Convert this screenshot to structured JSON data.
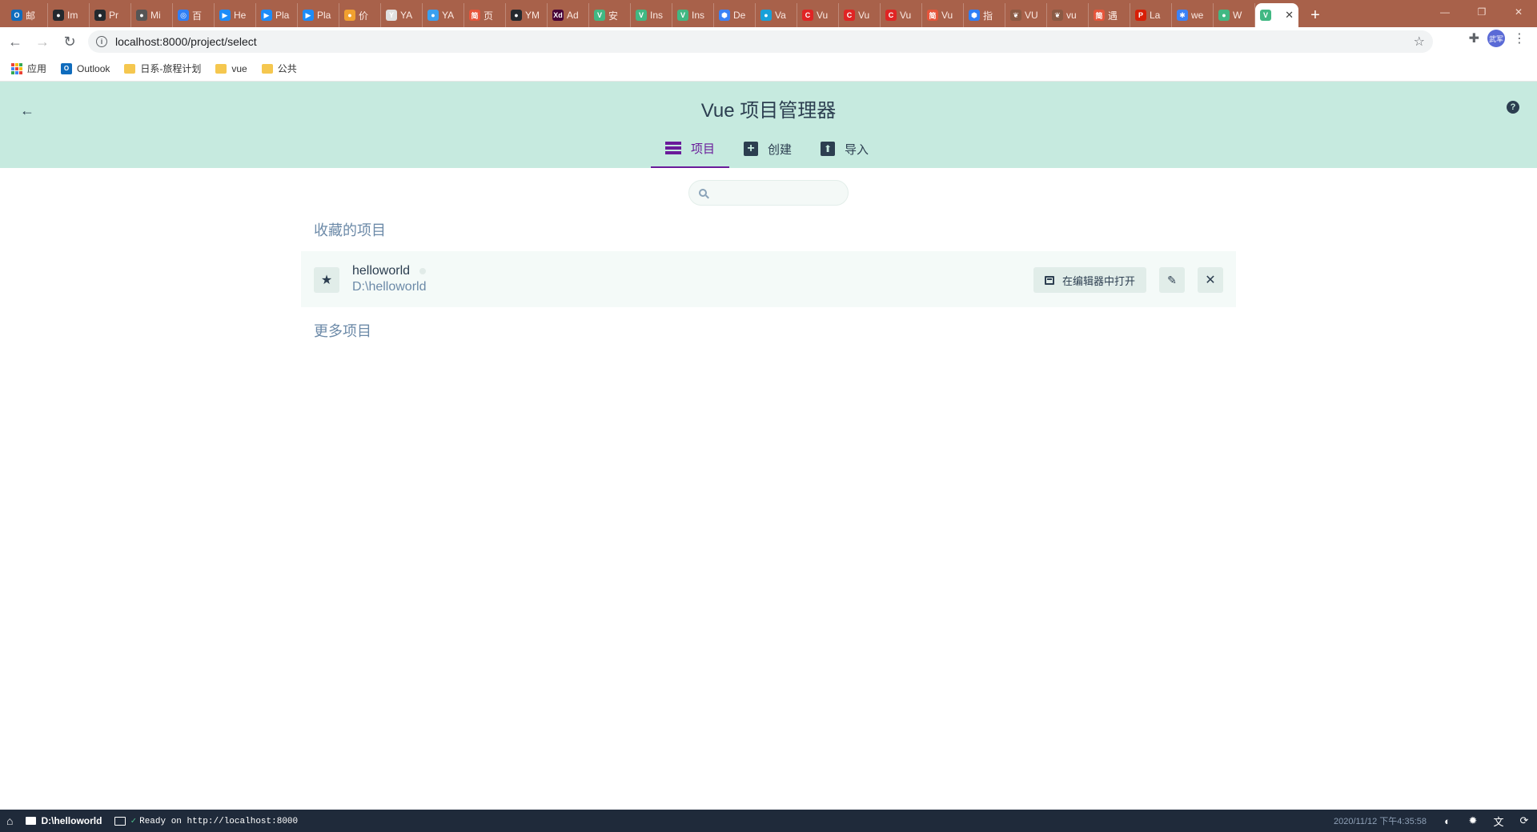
{
  "browser": {
    "tabs": [
      {
        "label": "邮",
        "color": "#0f6cbd",
        "glyph": "O"
      },
      {
        "label": "Im",
        "color": "#24292e",
        "glyph": "●"
      },
      {
        "label": "Pr",
        "color": "#24292e",
        "glyph": "●"
      },
      {
        "label": "Mi",
        "color": "#555555",
        "glyph": "●"
      },
      {
        "label": "百",
        "color": "#2f7ff6",
        "glyph": "◎"
      },
      {
        "label": "He",
        "color": "#1d8cf8",
        "glyph": "▶"
      },
      {
        "label": "Pla",
        "color": "#1d8cf8",
        "glyph": "▶"
      },
      {
        "label": "Pla",
        "color": "#1d8cf8",
        "glyph": "▶"
      },
      {
        "label": "价",
        "color": "#f0a030",
        "glyph": "●"
      },
      {
        "label": "YA",
        "color": "#e0e0e0",
        "glyph": "Y"
      },
      {
        "label": "YA",
        "color": "#3aa0f0",
        "glyph": "●"
      },
      {
        "label": "页",
        "color": "#e6553b",
        "glyph": "简"
      },
      {
        "label": "YM",
        "color": "#24292e",
        "glyph": "●"
      },
      {
        "label": "Ad",
        "color": "#470137",
        "glyph": "Xd"
      },
      {
        "label": "安",
        "color": "#41b883",
        "glyph": "V"
      },
      {
        "label": "Ins",
        "color": "#41b883",
        "glyph": "V"
      },
      {
        "label": "Ins",
        "color": "#41b883",
        "glyph": "V"
      },
      {
        "label": "De",
        "color": "#3b82f6",
        "glyph": "⬢"
      },
      {
        "label": "Va",
        "color": "#18a0d8",
        "glyph": "●"
      },
      {
        "label": "Vu",
        "color": "#e02424",
        "glyph": "C"
      },
      {
        "label": "Vu",
        "color": "#e02424",
        "glyph": "C"
      },
      {
        "label": "Vu",
        "color": "#e02424",
        "glyph": "C"
      },
      {
        "label": "Vu",
        "color": "#e6553b",
        "glyph": "简"
      },
      {
        "label": "指",
        "color": "#2f7ff6",
        "glyph": "⬢"
      },
      {
        "label": "VU",
        "color": "#8a5a44",
        "glyph": "❦"
      },
      {
        "label": "vu",
        "color": "#8a5a44",
        "glyph": "❦"
      },
      {
        "label": "遇",
        "color": "#e6553b",
        "glyph": "简"
      },
      {
        "label": "La",
        "color": "#d81e06",
        "glyph": "P"
      },
      {
        "label": "we",
        "color": "#3b82f6",
        "glyph": "✱"
      },
      {
        "label": "W",
        "color": "#41b883",
        "glyph": "●"
      }
    ],
    "active_tab_glyph": "V",
    "active_tab_color": "#41b883",
    "url": "localhost:8000/project/select",
    "profile_label": "武军",
    "bookmarks": [
      {
        "label": "应用",
        "type": "apps"
      },
      {
        "label": "Outlook",
        "type": "outlook"
      },
      {
        "label": "日系-旅程计划",
        "type": "folder"
      },
      {
        "label": "vue",
        "type": "folder"
      },
      {
        "label": "公共",
        "type": "folder"
      }
    ]
  },
  "header": {
    "title": "Vue 项目管理器",
    "back_icon": "arrow-left-icon",
    "help_icon": "question-icon",
    "tabs": [
      {
        "label": "项目",
        "icon": "list-icon",
        "active": true
      },
      {
        "label": "创建",
        "icon": "plus-square-icon",
        "active": false
      },
      {
        "label": "导入",
        "icon": "import-icon",
        "active": false
      }
    ]
  },
  "search": {
    "value": "",
    "placeholder": ""
  },
  "sections": {
    "favorites": "收藏的项目",
    "more": "更多项目"
  },
  "favorite_projects": [
    {
      "name": "helloworld",
      "path": "D:\\helloworld",
      "open_in_editor_label": "在编辑器中打开"
    }
  ],
  "statusbar": {
    "cwd": "D:\\helloworld",
    "log": "Ready on http://localhost:8000",
    "datetime": "2020/11/12 下午4:35:58"
  },
  "colors": {
    "header_bg": "#c6eadf",
    "accent": "#6a1b9a",
    "text": "#2c3e50",
    "statusbar_bg": "#1f2a3a",
    "tabstrip_bg": "#a8614a"
  }
}
